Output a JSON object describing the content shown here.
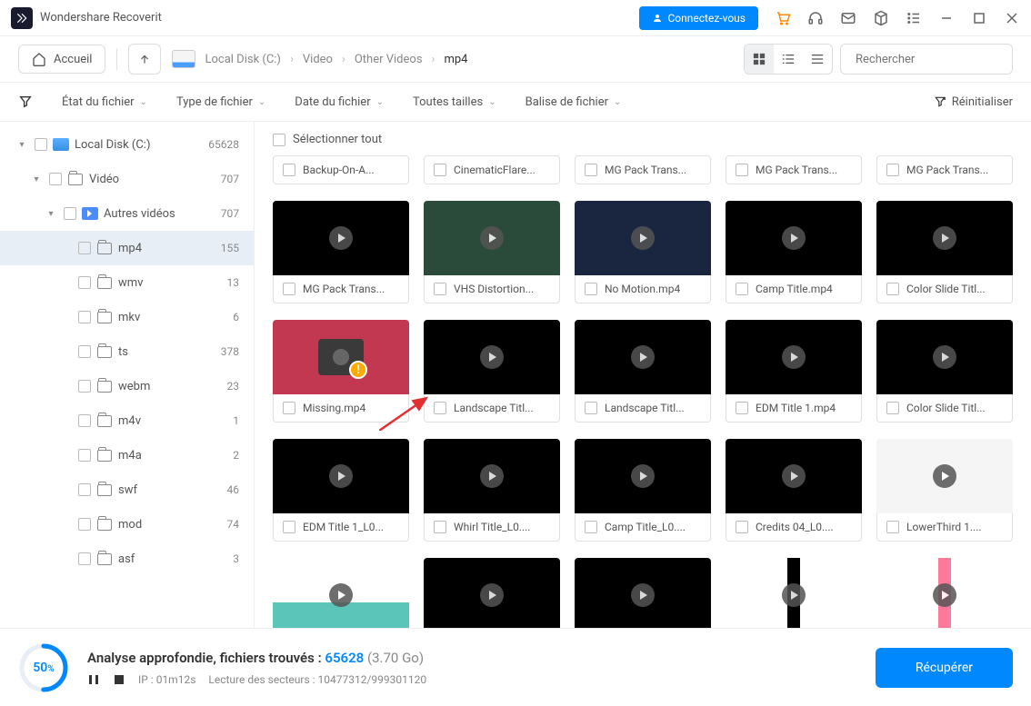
{
  "app": {
    "title": "Wondershare Recoverit",
    "connect": "Connectez-vous"
  },
  "nav": {
    "home": "Accueil"
  },
  "breadcrumb": {
    "disk": "Local Disk (C:)",
    "video": "Video",
    "other": "Other Videos",
    "mp4": "mp4"
  },
  "search": {
    "placeholder": "Rechercher"
  },
  "filters": {
    "state": "État du fichier",
    "type": "Type de fichier",
    "date": "Date du fichier",
    "size": "Toutes tailles",
    "tag": "Balise de fichier",
    "reset": "Réinitialiser"
  },
  "tree": {
    "disk": {
      "label": "Local Disk (C:)",
      "count": "65628"
    },
    "video": {
      "label": "Vidéo",
      "count": "707"
    },
    "other": {
      "label": "Autres vidéos",
      "count": "707"
    },
    "mp4": {
      "label": "mp4",
      "count": "155"
    },
    "wmv": {
      "label": "wmv",
      "count": "13"
    },
    "mkv": {
      "label": "mkv",
      "count": "6"
    },
    "ts": {
      "label": "ts",
      "count": "378"
    },
    "webm": {
      "label": "webm",
      "count": "23"
    },
    "m4v": {
      "label": "m4v",
      "count": "1"
    },
    "m4a": {
      "label": "m4a",
      "count": "2"
    },
    "swf": {
      "label": "swf",
      "count": "46"
    },
    "mod": {
      "label": "mod",
      "count": "74"
    },
    "asf": {
      "label": "asf",
      "count": "3"
    }
  },
  "selectAll": "Sélectionner tout",
  "topfiles": [
    "Backup-On-A...",
    "CinematicFlare...",
    "MG Pack Trans...",
    "MG Pack Trans...",
    "MG Pack Trans..."
  ],
  "row1": [
    "MG Pack Trans...",
    "VHS Distortion...",
    "No Motion.mp4",
    "Camp Title.mp4",
    "Color Slide Titl..."
  ],
  "row2": [
    "Missing.mp4",
    "Landscape Titl...",
    "Landscape Titl...",
    "EDM Title 1.mp4",
    "Color Slide Titl..."
  ],
  "row3": [
    "EDM Title 1_L0...",
    "Whirl Title_L0....",
    "Camp Title_L0....",
    "Credits 04_L0....",
    "LowerThird 1...."
  ],
  "footer": {
    "progress": "50",
    "pctSign": "%",
    "statusLabel": "Analyse approfondie, fichiers trouvés : ",
    "count": "65628",
    "size": "(3.70 Go)",
    "ip": "IP : 01m12s",
    "sectors": "Lecture des secteurs : 10477312/999301120",
    "recover": "Récupérer"
  }
}
